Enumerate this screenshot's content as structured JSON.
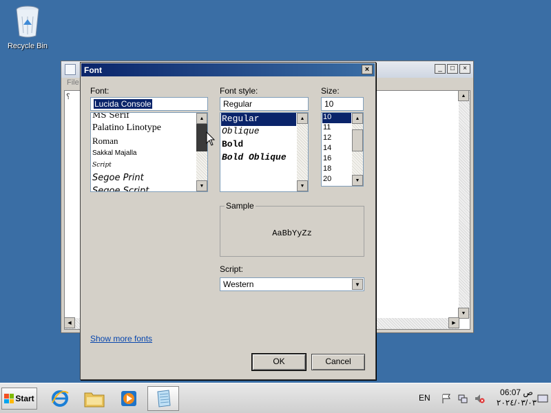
{
  "desktop": {
    "recycle_bin_label": "Recycle Bin"
  },
  "notepad": {
    "menu_first": "File",
    "content_char": "؟",
    "caption_buttons": [
      "_",
      "□",
      "×"
    ]
  },
  "dialog": {
    "title": "Font",
    "close_glyph": "×",
    "font_label": "Font:",
    "font_value": "Lucida Console",
    "font_list": [
      "MS Serif",
      "Palatino Linotype",
      "Roman",
      "Sakkal Majalla",
      "Script",
      "Segoe Print",
      "Segoe Script"
    ],
    "style_label": "Font style:",
    "style_value": "Regular",
    "style_list": [
      "Regular",
      "Oblique",
      "Bold",
      "Bold Oblique"
    ],
    "size_label": "Size:",
    "size_value": "10",
    "size_list": [
      "10",
      "11",
      "12",
      "14",
      "16",
      "18",
      "20"
    ],
    "sample_label": "Sample",
    "sample_text": "AaBbYyZz",
    "script_label": "Script:",
    "script_value": "Western",
    "show_more_link": "Show more fonts",
    "ok_label": "OK",
    "cancel_label": "Cancel"
  },
  "taskbar": {
    "start_label": "Start",
    "apps": [
      "internet-explorer",
      "windows-explorer",
      "media-player",
      "notepad"
    ],
    "active_app": "notepad",
    "language": "EN",
    "time": "06:07 ص",
    "date": "٢٠٢٤/٠٣/٠٣"
  },
  "colors": {
    "desktop": "#3a6ea5",
    "selection": "#0a246a",
    "link": "#0645ad"
  }
}
